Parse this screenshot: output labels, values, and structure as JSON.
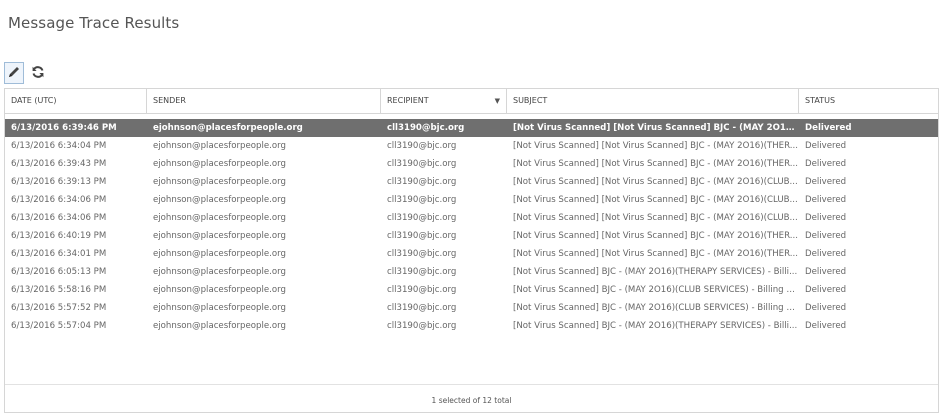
{
  "page": {
    "title": "Message Trace Results"
  },
  "toolbar": {
    "edit_icon": "pencil-icon",
    "refresh_icon": "refresh-icon"
  },
  "grid": {
    "columns": [
      {
        "key": "date",
        "label": "DATE (UTC)"
      },
      {
        "key": "sender",
        "label": "SENDER"
      },
      {
        "key": "recipient",
        "label": "RECIPIENT",
        "sort": "descending"
      },
      {
        "key": "subject",
        "label": "SUBJECT"
      },
      {
        "key": "status",
        "label": "STATUS"
      }
    ],
    "rows": [
      {
        "date": "6/13/2016 6:39:46 PM",
        "sender": "ejohnson@placesforpeople.org",
        "recipient": "cll3190@bjc.org",
        "subject": "[Not Virus Scanned] [Not Virus Scanned] BJC - (MAY 2O16)(CLUB...",
        "status": "Delivered",
        "selected": true
      },
      {
        "date": "6/13/2016 6:34:04 PM",
        "sender": "ejohnson@placesforpeople.org",
        "recipient": "cll3190@bjc.org",
        "subject": "[Not Virus Scanned] [Not Virus Scanned] BJC - (MAY 2O16)(THER...",
        "status": "Delivered",
        "selected": false
      },
      {
        "date": "6/13/2016 6:39:43 PM",
        "sender": "ejohnson@placesforpeople.org",
        "recipient": "cll3190@bjc.org",
        "subject": "[Not Virus Scanned] [Not Virus Scanned] BJC - (MAY 2O16)(THER...",
        "status": "Delivered",
        "selected": false
      },
      {
        "date": "6/13/2016 6:39:13 PM",
        "sender": "ejohnson@placesforpeople.org",
        "recipient": "cll3190@bjc.org",
        "subject": "[Not Virus Scanned] [Not Virus Scanned] BJC - (MAY 2O16)(CLUB...",
        "status": "Delivered",
        "selected": false
      },
      {
        "date": "6/13/2016 6:34:06 PM",
        "sender": "ejohnson@placesforpeople.org",
        "recipient": "cll3190@bjc.org",
        "subject": "[Not Virus Scanned] [Not Virus Scanned] BJC - (MAY 2O16)(CLUB...",
        "status": "Delivered",
        "selected": false
      },
      {
        "date": "6/13/2016 6:34:06 PM",
        "sender": "ejohnson@placesforpeople.org",
        "recipient": "cll3190@bjc.org",
        "subject": "[Not Virus Scanned] [Not Virus Scanned] BJC - (MAY 2O16)(CLUB...",
        "status": "Delivered",
        "selected": false
      },
      {
        "date": "6/13/2016 6:40:19 PM",
        "sender": "ejohnson@placesforpeople.org",
        "recipient": "cll3190@bjc.org",
        "subject": "[Not Virus Scanned] [Not Virus Scanned] BJC - (MAY 2O16)(THER...",
        "status": "Delivered",
        "selected": false
      },
      {
        "date": "6/13/2016 6:34:01 PM",
        "sender": "ejohnson@placesforpeople.org",
        "recipient": "cll3190@bjc.org",
        "subject": "[Not Virus Scanned] [Not Virus Scanned] BJC - (MAY 2O16)(THER...",
        "status": "Delivered",
        "selected": false
      },
      {
        "date": "6/13/2016 6:05:13 PM",
        "sender": "ejohnson@placesforpeople.org",
        "recipient": "cll3190@bjc.org",
        "subject": "[Not Virus Scanned] BJC - (MAY 2O16)(THERAPY SERVICES) - Billi...",
        "status": "Delivered",
        "selected": false
      },
      {
        "date": "6/13/2016 5:58:16 PM",
        "sender": "ejohnson@placesforpeople.org",
        "recipient": "cll3190@bjc.org",
        "subject": "[Not Virus Scanned] BJC - (MAY 2O16)(CLUB SERVICES) - Billing L...",
        "status": "Delivered",
        "selected": false
      },
      {
        "date": "6/13/2016 5:57:52 PM",
        "sender": "ejohnson@placesforpeople.org",
        "recipient": "cll3190@bjc.org",
        "subject": "[Not Virus Scanned] BJC - (MAY 2O16)(CLUB SERVICES) - Billing L...",
        "status": "Delivered",
        "selected": false
      },
      {
        "date": "6/13/2016 5:57:04 PM",
        "sender": "ejohnson@placesforpeople.org",
        "recipient": "cll3190@bjc.org",
        "subject": "[Not Virus Scanned] BJC - (MAY 2O16)(THERAPY SERVICES) - Billi...",
        "status": "Delivered",
        "selected": false
      }
    ],
    "footer_text": "1 selected of 12 total"
  },
  "colors": {
    "selected_row_bg": "#6f6f6f",
    "border": "#d6d6d6"
  }
}
